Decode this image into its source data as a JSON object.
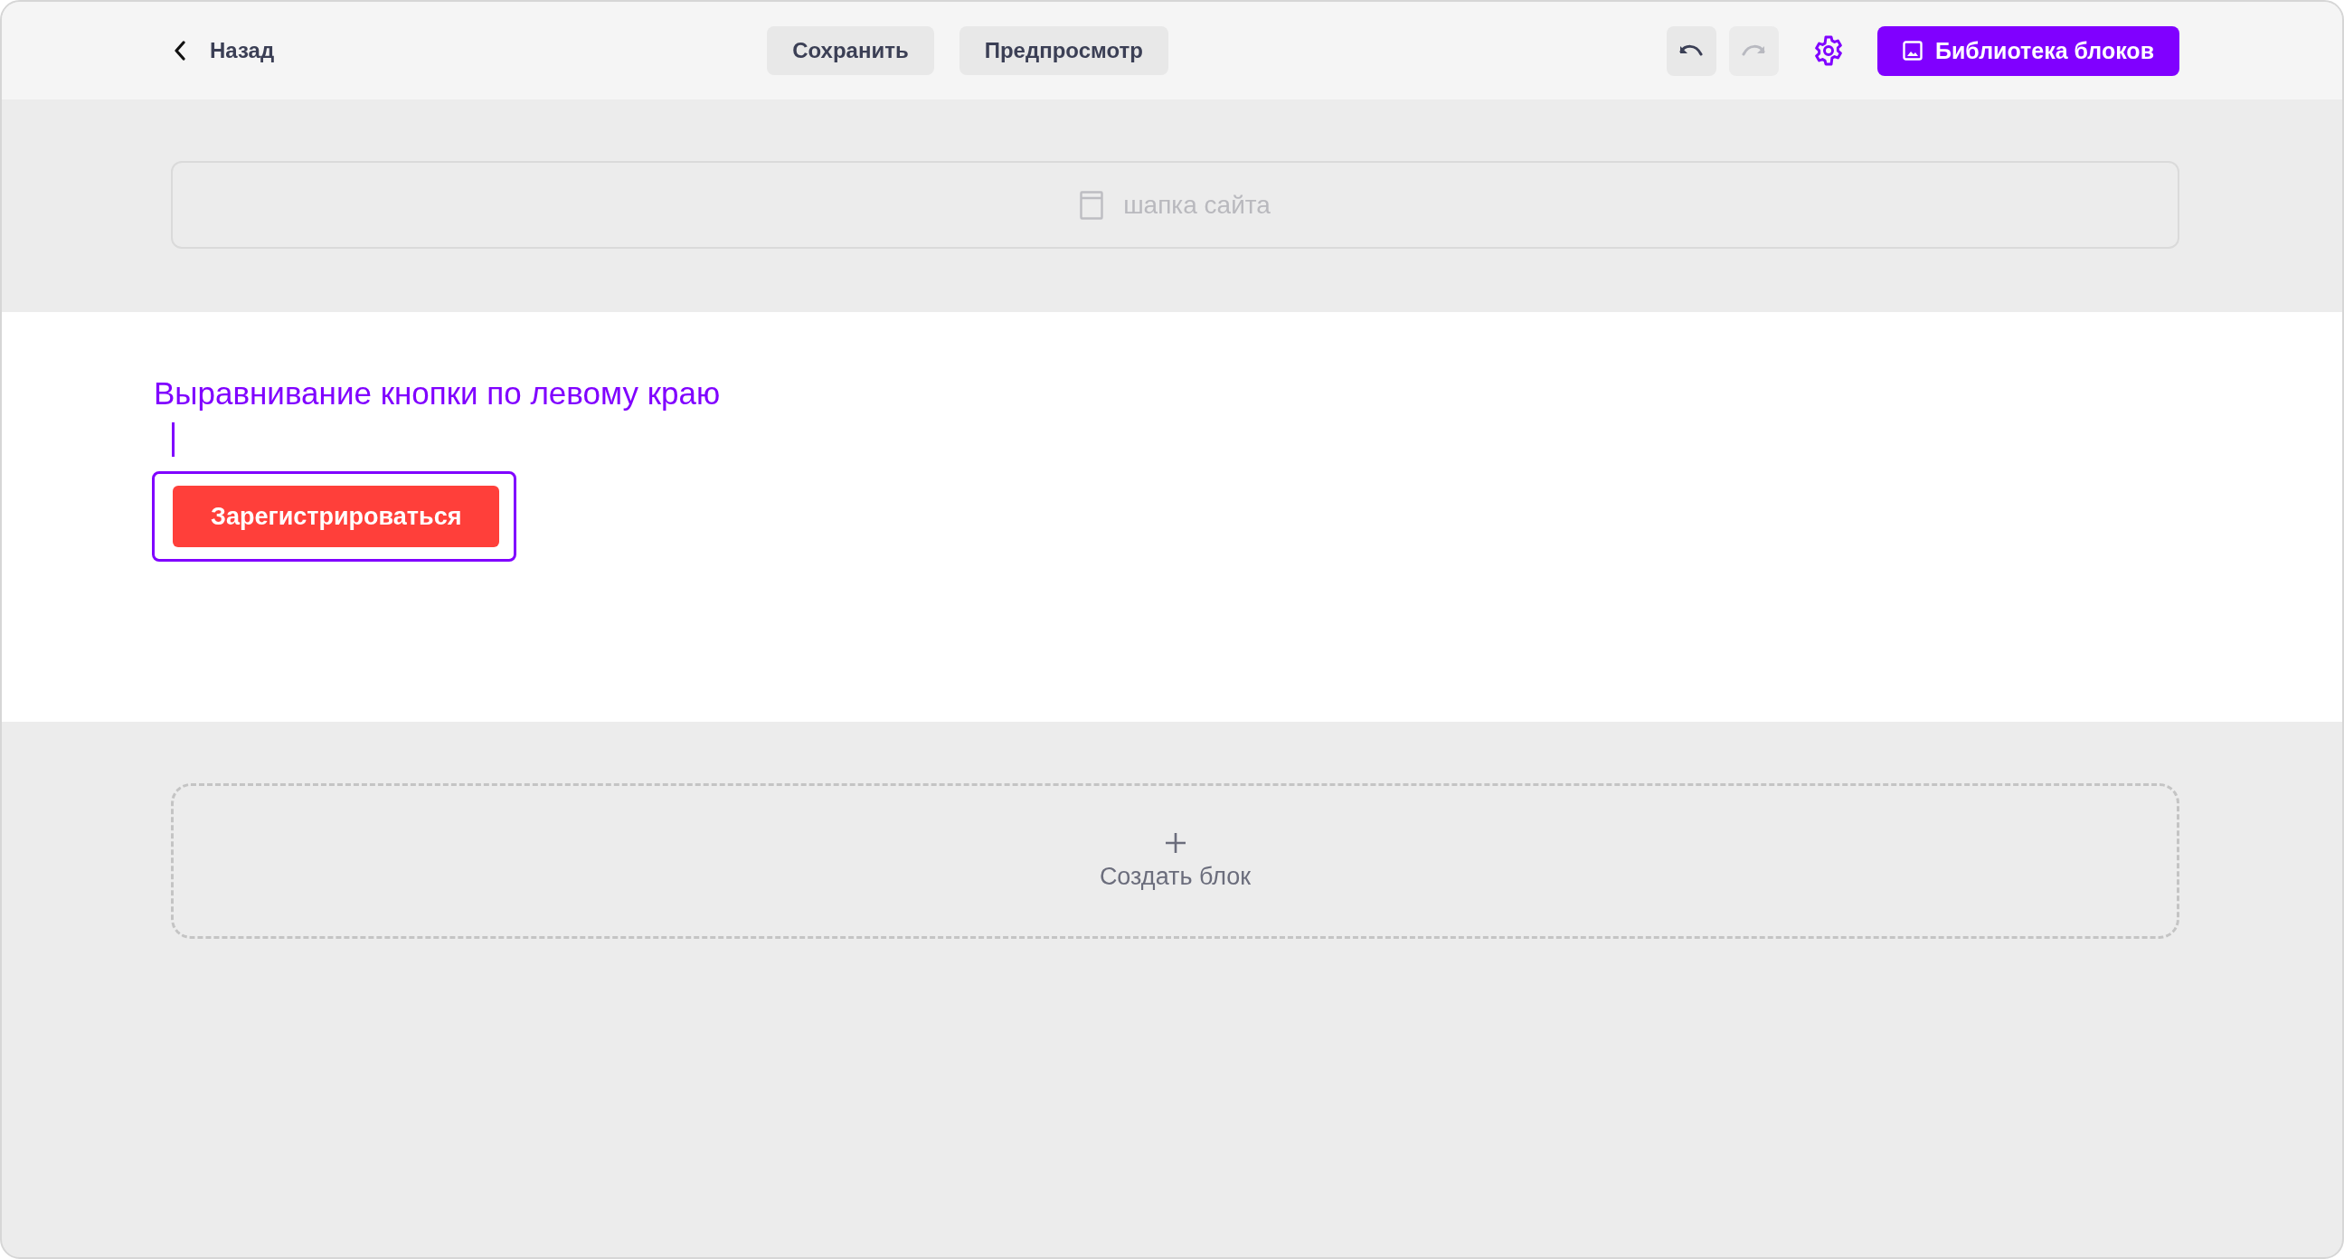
{
  "toolbar": {
    "back": "Назад",
    "actions": [
      {
        "label": "Сохранить"
      },
      {
        "label": "Предпросмотр"
      }
    ],
    "history": [
      {
        "kind": "undo",
        "disabled": false
      },
      {
        "kind": "redo",
        "disabled": true
      }
    ],
    "library": "Библиотека блоков"
  },
  "header_block": {
    "label": "шапка сайта"
  },
  "content_block": {
    "annotation": "Выравнивание кнопки по левому краю",
    "button": "Зарегистрироваться",
    "selected": true
  },
  "add_block": {
    "label": "Создать блок"
  }
}
